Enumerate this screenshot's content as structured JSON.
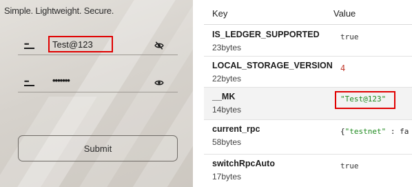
{
  "login": {
    "tagline": "Simple. Lightweight. Secure.",
    "password_field_1": {
      "value": "Test@123",
      "key_icon": "key-icon",
      "visibility_icon": "eye-slash-icon"
    },
    "password_field_2": {
      "value": "•••••••",
      "key_icon": "key-icon",
      "visibility_icon": "eye-icon"
    },
    "submit_label": "Submit"
  },
  "storage": {
    "headers": {
      "key": "Key",
      "value": "Value"
    },
    "rows": [
      {
        "key": "IS_LEDGER_SUPPORTED",
        "size": "23bytes",
        "value": "true"
      },
      {
        "key": "LOCAL_STORAGE_VERSION",
        "size": "22bytes",
        "value": "4"
      },
      {
        "key": "__MK",
        "size": "14bytes",
        "value": "\"Test@123\""
      },
      {
        "key": "current_rpc",
        "size": "58bytes",
        "value_prefix": "{",
        "value_key": "\"testnet\"",
        "value_suffix": " : fa"
      },
      {
        "key": "switchRpcAuto",
        "size": "17bytes",
        "value": "true"
      }
    ]
  },
  "colors": {
    "highlight": "#e00000",
    "string_value": "#1e8a1e",
    "number_value": "#c0392b"
  }
}
